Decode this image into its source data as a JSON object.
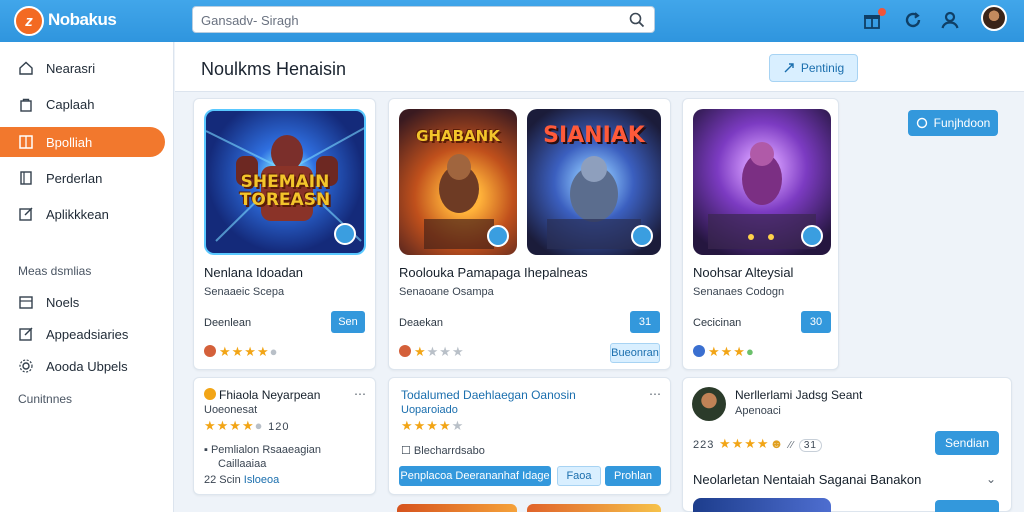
{
  "app": {
    "brand": "Nobakus",
    "logo_letter": "z"
  },
  "search": {
    "placeholder": "Gansadv- Siragh"
  },
  "sidebar": {
    "items": [
      {
        "label": "Nearasri",
        "icon": "home-icon"
      },
      {
        "label": "Caplaah",
        "icon": "bag-icon"
      },
      {
        "label": "Bpolliah",
        "icon": "grid-icon",
        "active": true
      },
      {
        "label": "Perderlan",
        "icon": "book-icon"
      },
      {
        "label": "Aplikkkean",
        "icon": "edit-icon"
      }
    ],
    "section_title": "Meas dsmlias",
    "sub_items": [
      {
        "label": "Noels",
        "icon": "folder-icon"
      },
      {
        "label": "Appeadsiaries",
        "icon": "edit-icon"
      },
      {
        "label": "Aooda Ubpels",
        "icon": "gear-icon"
      }
    ],
    "footer_label": "Cunitnnes"
  },
  "header": {
    "title": "Noulkms Henaisin",
    "action_label": "Pentinig"
  },
  "side_action_label": "Funjhdoon",
  "cards": [
    {
      "art_text": "SHEMAIN TOREASN",
      "title": "Nenlana Idoadan",
      "sub": "Senaaeic Scepa",
      "tag": "Deenlean",
      "price": "Sen",
      "rating": 4
    },
    {
      "art_left_text": "GHABANK",
      "art_right_text": "SIANIAK",
      "title": "Roolouka Pamapaga Ihepalneas",
      "sub": "Senaoane Osampa",
      "tag": "Deaekan",
      "price": "31",
      "rating": 2,
      "secondary_button": "Bueonran"
    },
    {
      "title": "Noohsar Alteysial",
      "sub": "Senanaes Codogn",
      "tag": "Cecicinan",
      "price": "30",
      "rating": 3
    }
  ],
  "lower_cards": [
    {
      "title": "Fhiaola Neyarpean",
      "sub": "Uoeonesat",
      "rating_value": "120",
      "detail": "Pemlialon Rsaaeagian",
      "detail2": "Caillaaiaa",
      "meta_prefix": "22 Scin",
      "meta_link": "Isloeoa"
    },
    {
      "title": "Todalumed Daehlaegan Oanosin",
      "sub": "Uoparoiado",
      "detail": "Blecharrdsabo",
      "buttons": [
        "Penplacoa Deerananhaf Idage",
        "Faoa",
        "Prohlan"
      ]
    },
    {
      "title": "Nerllerlami Jadsg Seant",
      "sub": "Apenoaci",
      "rating_prefix": "223",
      "rating_count": "31",
      "button": "Sendian",
      "footer": "Neolarletan Nentaiah Saganai Banakon"
    }
  ]
}
